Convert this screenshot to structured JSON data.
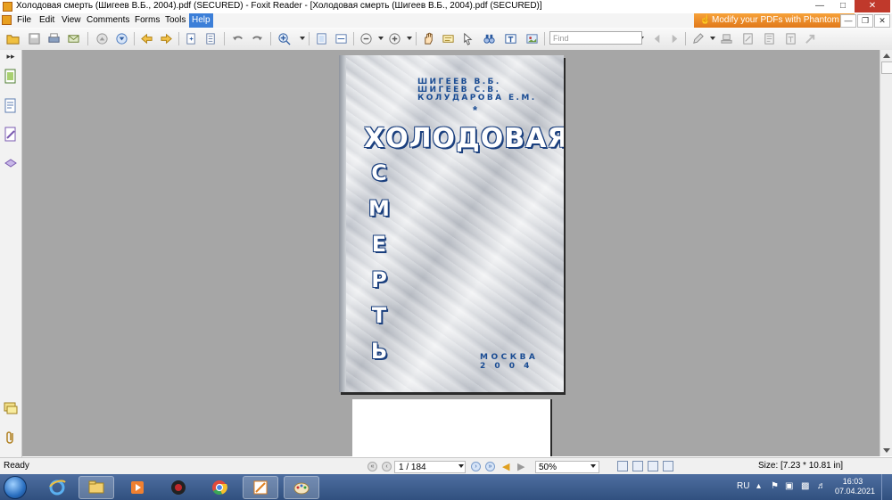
{
  "window": {
    "title": "Холодовая смерть (Шигеев В.Б., 2004).pdf (SECURED) - Foxit Reader - [Холодовая смерть (Шигеев В.Б., 2004).pdf (SECURED)]"
  },
  "menu": {
    "items": [
      "File",
      "Edit",
      "View",
      "Comments",
      "Forms",
      "Tools",
      "Help"
    ],
    "active": "Help"
  },
  "promo": {
    "label": "Modify your PDFs with Phantom"
  },
  "toolbar": {
    "find_placeholder": "Find"
  },
  "cover": {
    "authors": [
      "ШИГЕЕВ В.Б.",
      "ШИГЕЕВ С.В.",
      "КОЛУДАРОВА Е.М."
    ],
    "star": "*",
    "title_line1": "ХОЛОДОВАЯ",
    "title_vertical": [
      "С",
      "М",
      "Е",
      "Р",
      "Т",
      "Ь"
    ],
    "city": "МОСКВА",
    "year": "2 0 0 4"
  },
  "status": {
    "ready": "Ready",
    "page": "1 / 184",
    "zoom": "50%",
    "size": "Size: [7.23 * 10.81 in]"
  },
  "taskbar": {
    "lang": "RU",
    "time": "16:03",
    "date": "07.04.2021"
  }
}
